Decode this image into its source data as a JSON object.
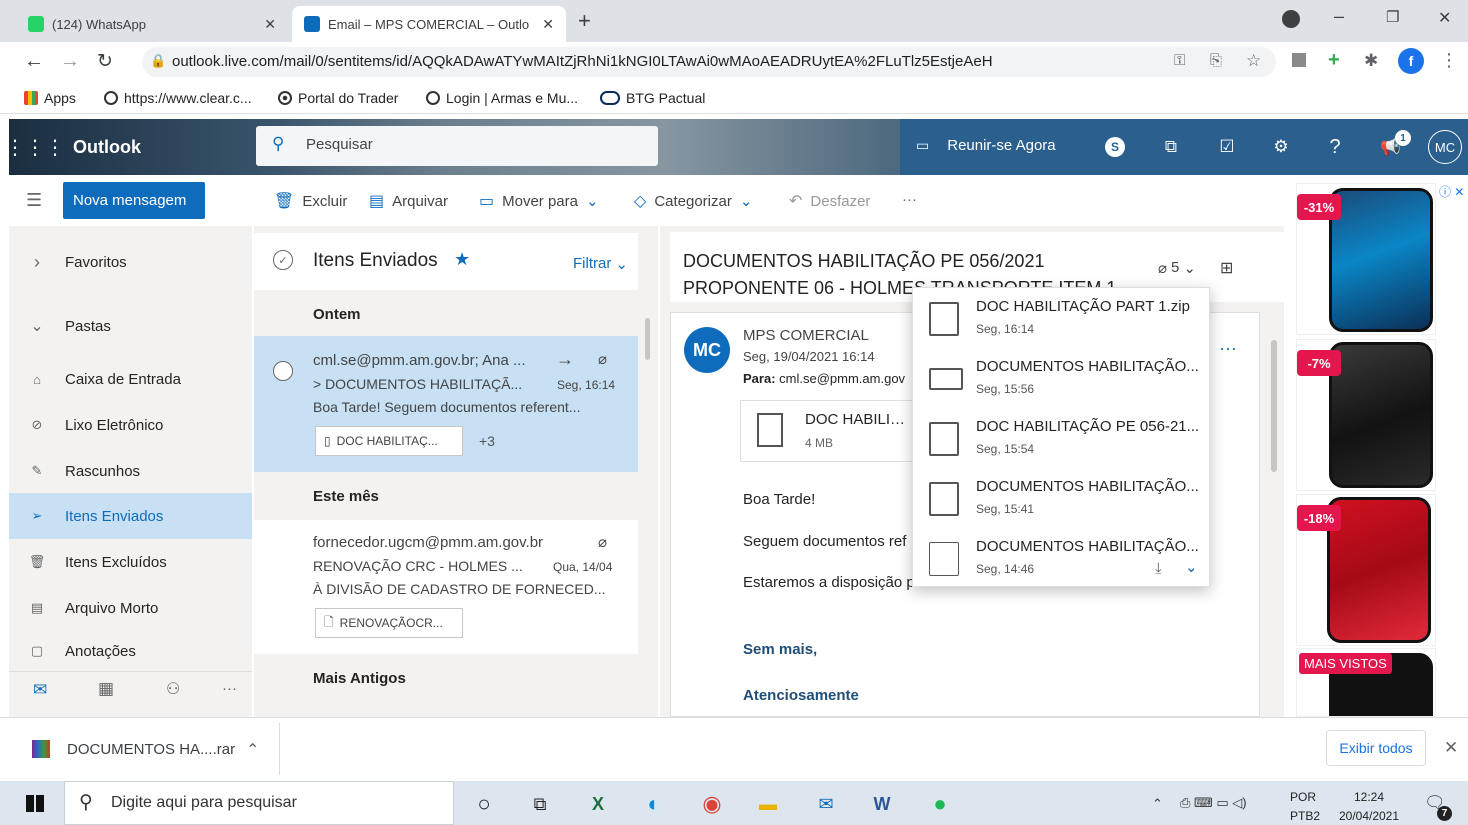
{
  "browser": {
    "tabs": [
      {
        "title": "(124) WhatsApp",
        "active": false,
        "icon": "whatsapp-icon",
        "color": "#25d366"
      },
      {
        "title": "Email – MPS COMERCIAL – Outlo",
        "active": true,
        "icon": "outlook-icon",
        "color": "#0f6cbd"
      }
    ],
    "url": "outlook.live.com/mail/0/sentitems/id/AQQkADAwATYwMAItZjRhNi1kNGI0LTAwAi0wMAoAEADRUytEA%2FLuTlz5EstjeAeH",
    "bookmarks": [
      {
        "label": "Apps",
        "icon": "apps-grid-icon"
      },
      {
        "label": "https://www.clear.c...",
        "icon": "globe-icon"
      },
      {
        "label": "Portal do Trader",
        "icon": "radio-icon"
      },
      {
        "label": "Login | Armas e Mu...",
        "icon": "globe-icon"
      },
      {
        "label": "BTG Pactual",
        "icon": "btg-icon"
      }
    ],
    "profile_initial": "f"
  },
  "outlook": {
    "brand": "Outlook",
    "search_placeholder": "Pesquisar",
    "meet_now": "Reunir-se Agora",
    "user_initials": "MC",
    "notification_count": "1"
  },
  "commands": {
    "new_message": "Nova mensagem",
    "delete": "Excluir",
    "archive": "Arquivar",
    "move_to": "Mover para",
    "categorize": "Categorizar",
    "undo": "Desfazer"
  },
  "nav": {
    "favorites": "Favoritos",
    "folders": "Pastas",
    "items": [
      {
        "label": "Caixa de Entrada",
        "icon": "inbox-icon",
        "selected": false
      },
      {
        "label": "Lixo Eletrônico",
        "icon": "junk-icon",
        "selected": false
      },
      {
        "label": "Rascunhos",
        "icon": "pencil-icon",
        "selected": false
      },
      {
        "label": "Itens Enviados",
        "icon": "send-icon",
        "selected": true
      },
      {
        "label": "Itens Excluídos",
        "icon": "trash-icon",
        "selected": false
      },
      {
        "label": "Arquivo Morto",
        "icon": "archive-icon",
        "selected": false
      },
      {
        "label": "Anotações",
        "icon": "note-icon",
        "selected": false
      }
    ]
  },
  "list": {
    "title": "Itens Enviados",
    "filter": "Filtrar",
    "groups": {
      "yesterday": "Ontem",
      "this_month": "Este mês",
      "older": "Mais Antigos"
    },
    "messages": [
      {
        "to": "cml.se@pmm.am.gov.br; Ana ...",
        "subject": "> DOCUMENTOS HABILITAÇÃ...",
        "time": "Seg, 16:14",
        "preview": "Boa Tarde! Seguem documentos referent...",
        "chip": "DOC HABILITAÇ...",
        "more": "+3"
      },
      {
        "to": "fornecedor.ugcm@pmm.am.gov.br",
        "subject": "RENOVAÇÃO CRC - HOLMES ...",
        "time": "Qua, 14/04",
        "preview": "À DIVISÃO DE CADASTRO DE FORNECED...",
        "chip": "RENOVAÇÃOCR..."
      }
    ]
  },
  "reading": {
    "subject_line1": "DOCUMENTOS HABILITAÇÃO PE 056/2021",
    "subject_line2": "PROPONENTE 06 - HOLMES TRANSPORTE ITEM 1",
    "attach_count": "5",
    "sender": "MPS COMERCIAL",
    "avatar": "MC",
    "date": "Seg, 19/04/2021 16:14",
    "to_label": "Para:",
    "to_value": "cml.se@pmm.am.gov",
    "attachment_name": "DOC HABILITAC",
    "attachment_size": "4 MB",
    "body": [
      "Boa Tarde!",
      "Seguem documentos ref",
      "Estaremos a disposição p"
    ],
    "sign1": "Sem mais,",
    "sign2": "Atenciosamente"
  },
  "attachments_popup": [
    {
      "name": "DOC HABILITAÇÃO PART 1.zip",
      "time": "Seg, 16:14",
      "icon": "zip-icon"
    },
    {
      "name": "DOCUMENTOS HABILITAÇÃO...",
      "time": "Seg, 15:56",
      "icon": "mail-icon"
    },
    {
      "name": "DOC HABILITAÇÃO PE 056-21...",
      "time": "Seg, 15:54",
      "icon": "zip-icon"
    },
    {
      "name": "DOCUMENTOS HABILITAÇÃO...",
      "time": "Seg, 15:41",
      "icon": "zip-icon"
    },
    {
      "name": "DOCUMENTOS HABILITAÇÃO...",
      "time": "Seg, 14:46",
      "icon": "file-icon"
    }
  ],
  "ads": {
    "badges": [
      "-31%",
      "-7%",
      "-18%"
    ],
    "label": "MAIS VISTOS"
  },
  "download": {
    "file": "DOCUMENTOS HA....rar",
    "show_all": "Exibir todos"
  },
  "taskbar": {
    "search": "Digite aqui para pesquisar",
    "lang1": "POR",
    "lang2": "PTB2",
    "time": "12:24",
    "date": "20/04/2021",
    "notifications": "7"
  },
  "colors": {
    "accent": "#0f6cbd",
    "selection": "#c7e0f4",
    "ad_badge": "#e3174d"
  }
}
